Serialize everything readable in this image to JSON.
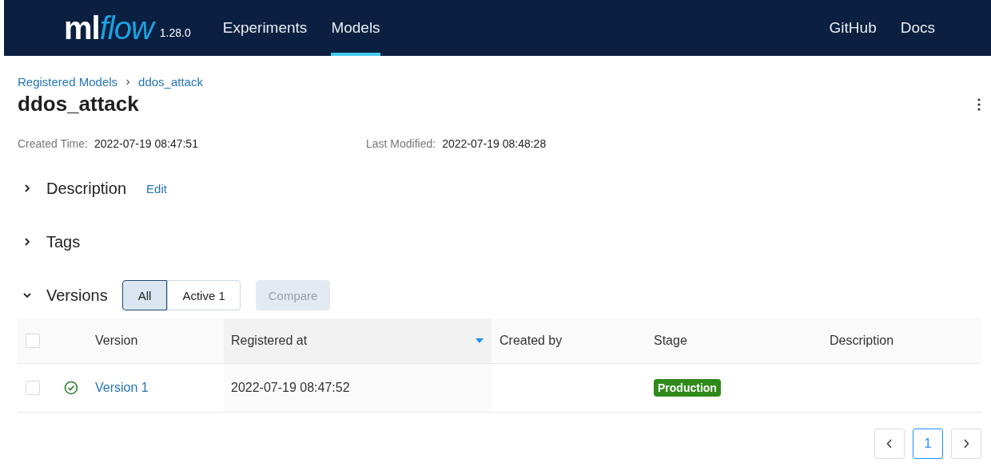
{
  "header": {
    "logo": {
      "text": "ml",
      "accent": "flow"
    },
    "version": "1.28.0",
    "nav": [
      {
        "label": "Experiments",
        "selected": false
      },
      {
        "label": "Models",
        "selected": true
      }
    ],
    "links": [
      "GitHub",
      "Docs"
    ]
  },
  "breadcrumb": [
    "Registered Models",
    "ddos_attack"
  ],
  "title": "ddos_attack",
  "meta": [
    {
      "label": "Created Time:",
      "value": "2022-07-19 08:47:51"
    },
    {
      "label": "Last Modified:",
      "value": "2022-07-19 08:48:28"
    }
  ],
  "sections": [
    {
      "title": "Description",
      "expanded": false,
      "action": "Edit"
    },
    {
      "title": "Tags",
      "expanded": false
    },
    {
      "title": "Versions",
      "expanded": true
    }
  ],
  "version_filter": [
    {
      "label": "All",
      "selected": true
    },
    {
      "label": "Active 1",
      "selected": false
    }
  ],
  "compare_button": {
    "label": "Compare",
    "disabled": true
  },
  "table": {
    "select_all_checked": false,
    "columns": [
      {
        "label": "Version",
        "sorted": false
      },
      {
        "label": "Registered at",
        "sorted": true
      },
      {
        "label": "Created by",
        "sorted": false
      },
      {
        "label": "Stage",
        "sorted": false
      },
      {
        "label": "Description",
        "sorted": false
      }
    ],
    "rows": [
      {
        "checked": false,
        "version": "Version 1",
        "registered_at": "2022-07-19 08:47:52",
        "stage": "Production"
      }
    ]
  },
  "pagination": [
    {
      "label": "1",
      "selected": true
    }
  ]
}
